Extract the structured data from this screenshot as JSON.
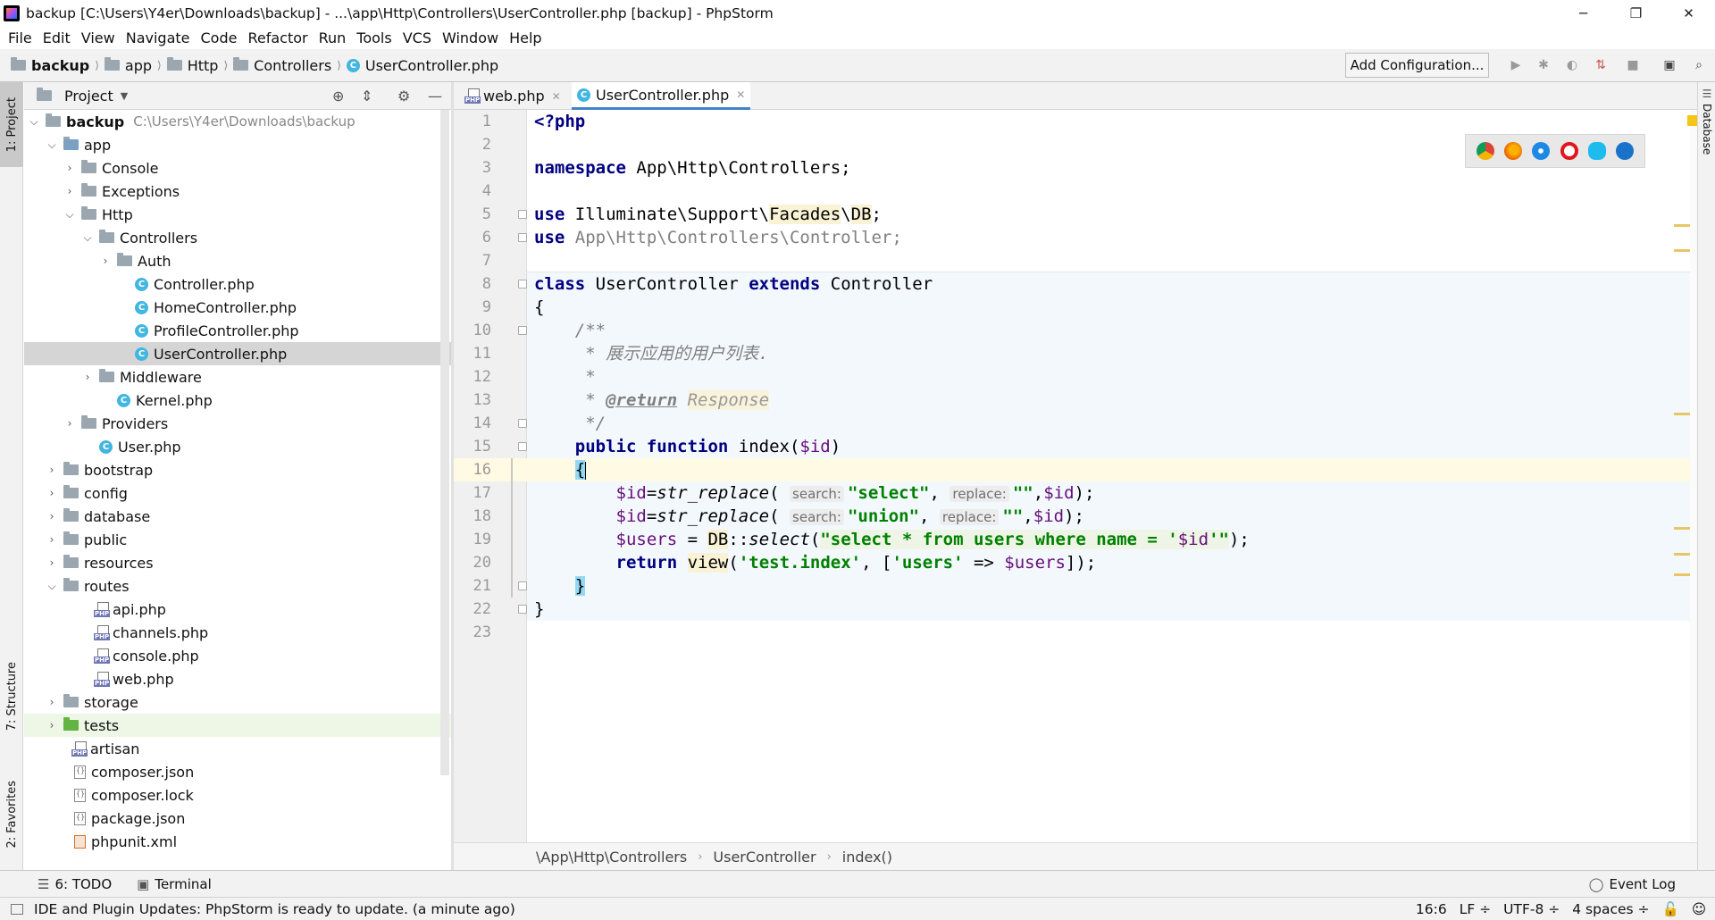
{
  "window": {
    "title": "backup [C:\\Users\\Y4er\\Downloads\\backup] - ...\\app\\Http\\Controllers\\UserController.php [backup] - PhpStorm",
    "minimize": "─",
    "restore": "❐",
    "close": "✕"
  },
  "menu": [
    "File",
    "Edit",
    "View",
    "Navigate",
    "Code",
    "Refactor",
    "Run",
    "Tools",
    "VCS",
    "Window",
    "Help"
  ],
  "navbar": {
    "crumbs": [
      "backup",
      "app",
      "Http",
      "Controllers",
      "UserController.php"
    ],
    "add_configuration": "Add Configuration..."
  },
  "left_stripe": {
    "project": "1: Project",
    "structure": "7: Structure",
    "favorites": "2: Favorites"
  },
  "right_stripe": {
    "database": "Database"
  },
  "project_panel": {
    "title": "Project",
    "tree": [
      {
        "label": "backup",
        "note": "C:\\Users\\Y4er\\Downloads\\backup"
      },
      {
        "label": "app"
      },
      {
        "label": "Console"
      },
      {
        "label": "Exceptions"
      },
      {
        "label": "Http"
      },
      {
        "label": "Controllers"
      },
      {
        "label": "Auth"
      },
      {
        "label": "Controller.php"
      },
      {
        "label": "HomeController.php"
      },
      {
        "label": "ProfileController.php"
      },
      {
        "label": "UserController.php"
      },
      {
        "label": "Middleware"
      },
      {
        "label": "Kernel.php"
      },
      {
        "label": "Providers"
      },
      {
        "label": "User.php"
      },
      {
        "label": "bootstrap"
      },
      {
        "label": "config"
      },
      {
        "label": "database"
      },
      {
        "label": "public"
      },
      {
        "label": "resources"
      },
      {
        "label": "routes"
      },
      {
        "label": "api.php"
      },
      {
        "label": "channels.php"
      },
      {
        "label": "console.php"
      },
      {
        "label": "web.php"
      },
      {
        "label": "storage"
      },
      {
        "label": "tests"
      },
      {
        "label": "artisan"
      },
      {
        "label": "composer.json"
      },
      {
        "label": "composer.lock"
      },
      {
        "label": "package.json"
      },
      {
        "label": "phpunit.xml"
      }
    ]
  },
  "editor": {
    "tabs": [
      {
        "label": "web.php",
        "close": "✕"
      },
      {
        "label": "UserController.php",
        "close": "✕"
      }
    ],
    "line_numbers": [
      "1",
      "2",
      "3",
      "4",
      "5",
      "6",
      "7",
      "8",
      "9",
      "10",
      "11",
      "12",
      "13",
      "14",
      "15",
      "16",
      "17",
      "18",
      "19",
      "20",
      "21",
      "22",
      "23"
    ],
    "code": {
      "l1_open": "<?php",
      "l3_kw": "namespace",
      "l3_rest": " App\\Http\\Controllers;",
      "l5_kw": "use",
      "l5_a": " Illuminate\\Support\\",
      "l5_b": "Facades",
      "l5_c": "\\",
      "l5_d": "DB",
      ";": ";",
      "l6_kw": "use",
      "l6_rest": " App\\Http\\Controllers\\Controller;",
      "l8_kw1": "class",
      "l8_name": " UserController ",
      "l8_kw2": "extends",
      "l8_base": " Controller",
      "l9": "{",
      "l10": "    /**",
      "l11": "     * 展示应用的用户列表.",
      "l12": "     *",
      "l13_a": "     * ",
      "l13_tag": "@return",
      "l13_sp": " ",
      "l13_type": "Response",
      "l14": "     */",
      "l15_kw": "    public function",
      "l15_name": " index(",
      "l15_var": "$id",
      ")": ")",
      "l16_ind": "    ",
      "l16_brace": "{",
      "l17_var": "        $id",
      "l17_eq": "=",
      "l17_fn": "str_replace",
      "l17_p": "(",
      "l17_h1": "search:",
      "l17_s1": "\"select\"",
      "l17_c": ",",
      "l17_h2": "replace:",
      "l17_s2": "\"\"",
      "l17_end_a": ",",
      "l17_end_var": "$id",
      "l17_end": ");",
      "l18_var": "        $id",
      "l18_eq": "=",
      "l18_fn": "str_replace",
      "l18_p": "(",
      "l18_h1": "search:",
      "l18_s1": "\"union\"",
      "l18_c": ",",
      "l18_h2": "replace:",
      "l18_s2": "\"\"",
      "l18_end_a": ",",
      "l18_end_var": "$id",
      "l18_end": ");",
      "l19_var": "        $users",
      "l19_eq": " = ",
      "l19_db": "DB",
      "l19_sep": "::",
      "l19_fn": "select",
      "l19_p": "(",
      "l19_s": "\"select * from users where name = '",
      "l19_v": "$id",
      "l19_s2": "'\"",
      "l19_end": ");",
      "l20_kw": "        return",
      "l20_sp": " ",
      "l20_fn": "view",
      "l20_p": "(",
      "l20_s1": "'test.index'",
      "l20_m": ", [",
      "l20_s2": "'users'",
      "l20_a": " => ",
      "l20_v": "$users",
      "l20_end": "]);",
      "l21_ind": "    ",
      "l21_brace": "}",
      "l22": "}"
    },
    "breadcrumbs": [
      "\\App\\Http\\Controllers",
      "UserController",
      "index()"
    ]
  },
  "bottom_tools": {
    "todo": "6: TODO",
    "terminal": "Terminal",
    "event_log": "Event Log"
  },
  "status": {
    "message": "IDE and Plugin Updates: PhpStorm is ready to update. (a minute ago)",
    "position": "16:6",
    "line_sep": "LF ÷",
    "encoding": "UTF-8 ÷",
    "indent": "4 spaces ÷"
  },
  "colors": {
    "accent": "#4083c9",
    "keyword": "#000080",
    "string": "#008000",
    "variable": "#660e7a",
    "comment": "#808080"
  },
  "icons": [
    "folder-icon",
    "php-class-icon",
    "php-file-icon",
    "json-file-icon",
    "xml-file-icon",
    "chrome-icon",
    "firefox-icon",
    "safari-icon",
    "opera-icon",
    "ie-icon",
    "edge-icon"
  ]
}
